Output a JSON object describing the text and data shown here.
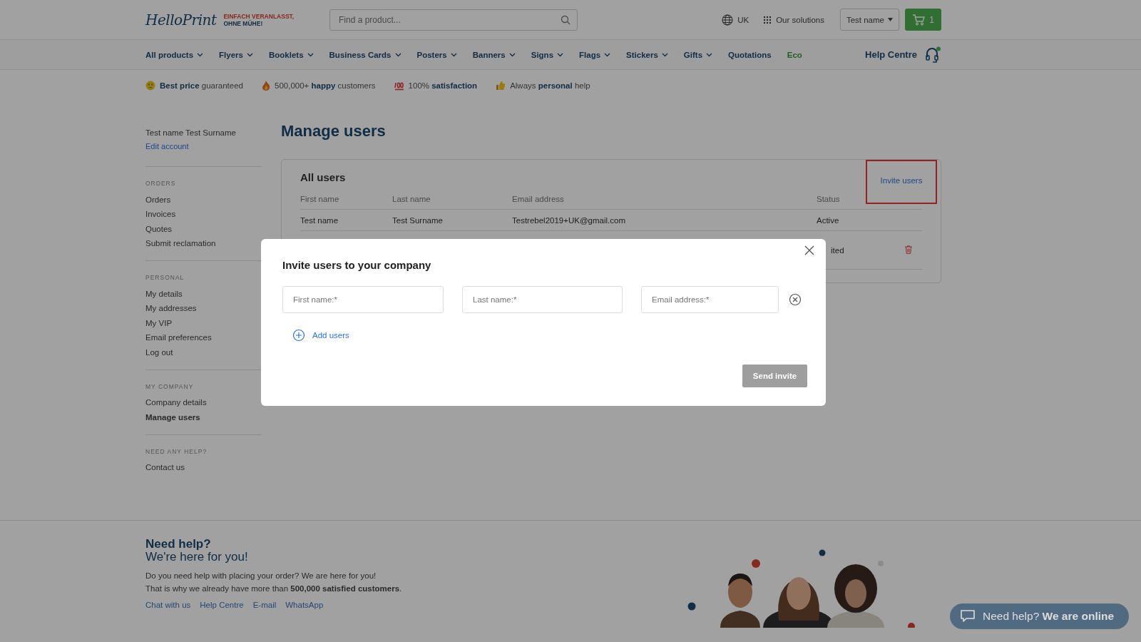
{
  "header": {
    "logo": "HelloPrint",
    "tagline": [
      "EINFACH VERANLASST,",
      "OHNE MÜHE!"
    ],
    "search": {
      "placeholder": "Find a product..."
    },
    "region": "UK",
    "solutions": "Our solutions",
    "account": "Test name",
    "cart_count": "1"
  },
  "nav": {
    "items": [
      {
        "label": "All products",
        "kind": "menu"
      },
      {
        "label": "Flyers",
        "kind": "menu"
      },
      {
        "label": "Booklets",
        "kind": "menu"
      },
      {
        "label": "Business Cards",
        "kind": "menu"
      },
      {
        "label": "Posters",
        "kind": "menu"
      },
      {
        "label": "Banners",
        "kind": "menu"
      },
      {
        "label": "Signs",
        "kind": "menu"
      },
      {
        "label": "Flags",
        "kind": "menu"
      },
      {
        "label": "Stickers",
        "kind": "menu"
      },
      {
        "label": "Gifts",
        "kind": "menu"
      },
      {
        "label": "Quotations",
        "kind": "link"
      },
      {
        "label": "Eco",
        "kind": "eco"
      }
    ],
    "help": "Help Centre"
  },
  "benefits": [
    {
      "kind": "money",
      "text": "**Best price** guaranteed"
    },
    {
      "kind": "fire",
      "text": "500,000+ **happy** customers"
    },
    {
      "kind": "hundred",
      "text": "100% **satisfaction**"
    },
    {
      "kind": "thumb",
      "text": "Always **personal** help"
    }
  ],
  "sidebar": {
    "user": "Test name Test Surname",
    "edit": "Edit account",
    "sections": [
      {
        "heading": "ORDERS",
        "items": [
          {
            "label": "Orders",
            "selected": false
          },
          {
            "label": "Invoices",
            "selected": false
          },
          {
            "label": "Quotes",
            "selected": false
          },
          {
            "label": "Submit reclamation",
            "selected": false
          }
        ]
      },
      {
        "heading": "PERSONAL",
        "items": [
          {
            "label": "My details",
            "selected": false
          },
          {
            "label": "My addresses",
            "selected": false
          },
          {
            "label": "My VIP",
            "selected": false
          },
          {
            "label": "Email preferences",
            "selected": false
          },
          {
            "label": "Log out",
            "selected": false
          }
        ]
      },
      {
        "heading": "MY COMPANY",
        "items": [
          {
            "label": "Company details",
            "selected": false
          },
          {
            "label": "Manage users",
            "selected": true
          }
        ]
      },
      {
        "heading": "NEED ANY HELP?",
        "items": [
          {
            "label": "Contact us",
            "selected": false
          }
        ]
      }
    ]
  },
  "page_title": "Manage users",
  "users": {
    "title": "All users",
    "invite": {
      "label": "Invite users",
      "highlighted": true
    },
    "columns": [
      "First name",
      "Last name",
      "Email address",
      "Status"
    ],
    "rows": [
      {
        "first_name": "Test name",
        "last_name": "Test Surname",
        "email": "Testrebel2019+UK@gmail.com",
        "status": "Active",
        "deletable": false
      },
      {
        "status": "ited",
        "deletable": true
      }
    ]
  },
  "modal": {
    "title": "Invite users to your company",
    "fields": [
      {
        "placeholder": "First name:*"
      },
      {
        "placeholder": "Last name:*"
      },
      {
        "placeholder": "Email address:*"
      }
    ],
    "add": "Add users",
    "send": {
      "label": "Send invite",
      "disabled": true
    }
  },
  "footer": {
    "title": [
      "Need help?",
      "We're here for you!"
    ],
    "text": [
      "Do you need help with placing your order? We are here for you!",
      "That is why we already have more than **500,000 satisfied customers**."
    ],
    "links": [
      "Chat with us",
      "Help Centre",
      "E-mail",
      "WhatsApp"
    ]
  },
  "chat": "Need help? **We are online**"
}
